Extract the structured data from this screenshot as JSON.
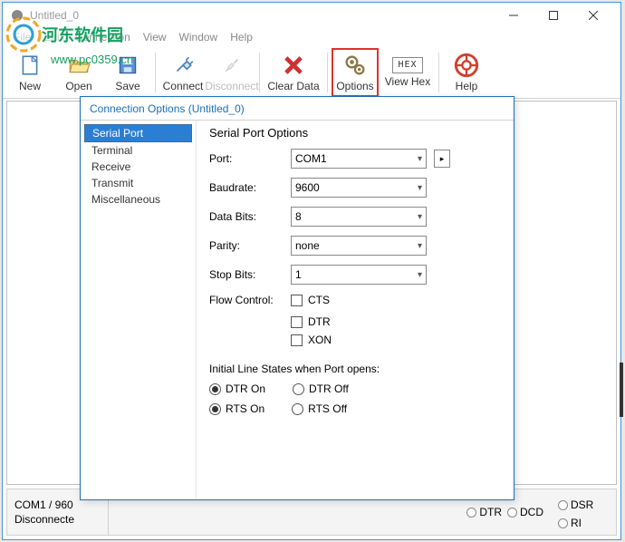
{
  "window": {
    "title": "Untitled_0"
  },
  "menu": {
    "file": "File",
    "edit": "Edit",
    "connection": "Connection",
    "view": "View",
    "window": "Window",
    "help": "Help"
  },
  "toolbar": {
    "new": "New",
    "open": "Open",
    "save": "Save",
    "connect": "Connect",
    "disconnect": "Disconnect",
    "clear_data": "Clear Data",
    "options": "Options",
    "view_hex": "View Hex",
    "help": "Help",
    "hex_label": "HEX"
  },
  "dialog": {
    "title": "Connection Options (Untitled_0)",
    "nav": {
      "serial_port": "Serial Port",
      "terminal": "Terminal",
      "receive": "Receive",
      "transmit": "Transmit",
      "misc": "Miscellaneous"
    },
    "section_title": "Serial Port Options",
    "port_label": "Port:",
    "port_value": "COM1",
    "baud_label": "Baudrate:",
    "baud_value": "9600",
    "databits_label": "Data Bits:",
    "databits_value": "8",
    "parity_label": "Parity:",
    "parity_value": "none",
    "stopbits_label": "Stop Bits:",
    "stopbits_value": "1",
    "flow_label": "Flow Control:",
    "cts": "CTS",
    "dtr": "DTR",
    "xon": "XON",
    "initial_label": "Initial Line States when Port opens:",
    "dtr_on": "DTR On",
    "dtr_off": "DTR Off",
    "rts_on": "RTS On",
    "rts_off": "RTS Off",
    "detach": "▸"
  },
  "status": {
    "port_info": "COM1 / 960",
    "state": "Disconnecte",
    "leds": {
      "dtr": "DTR",
      "dcd": "DCD",
      "dsr": "DSR",
      "ri": "RI"
    }
  },
  "watermark": {
    "text": "河东软件园",
    "url": "www.pc0359.cn"
  }
}
